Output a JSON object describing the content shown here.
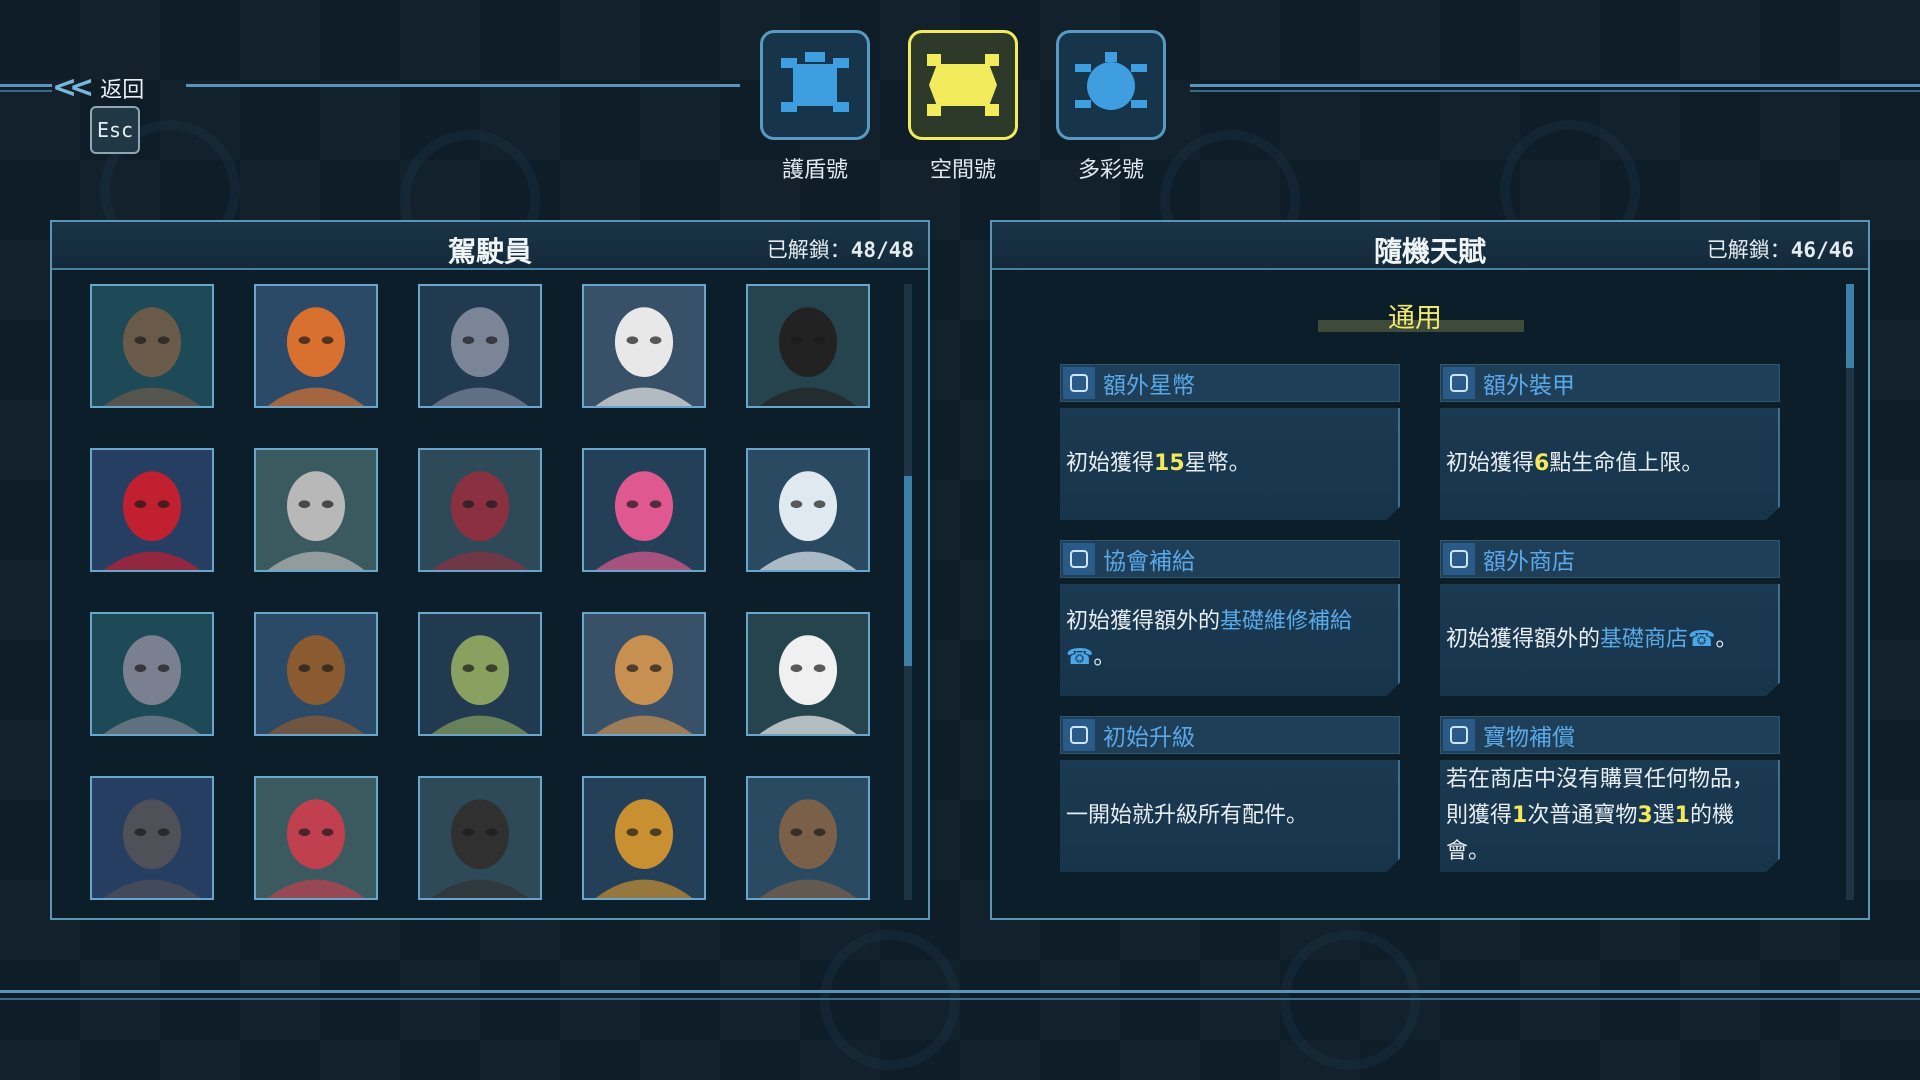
{
  "header": {
    "back_label": "返回",
    "esc_key": "Esc",
    "ships": [
      {
        "name": "護盾號",
        "icon": "shield-ship-icon",
        "active": false
      },
      {
        "name": "空間號",
        "icon": "space-ship-icon",
        "active": true
      },
      {
        "name": "多彩號",
        "icon": "colorful-ship-icon",
        "active": false
      }
    ]
  },
  "pilots_panel": {
    "title": "駕駛員",
    "unlocked_label": "已解鎖：",
    "unlocked_value": "48/48",
    "pilots": [
      "bearded-man-glasses",
      "orange-robot",
      "grey-robot",
      "hooded-figure",
      "black-dog",
      "red-mech",
      "husky-goggles",
      "girl-headphones",
      "pink-hair-girl",
      "white-hood-girl",
      "cyborg-scarf",
      "cowboy-robot",
      "green-hair-elf",
      "cat-scarf",
      "white-cat",
      "raccoon",
      "box-robot-hoodie",
      "man-headphones",
      "masked-blonde",
      "tree-ent"
    ],
    "scroll_fraction": 0.45
  },
  "talents_panel": {
    "title": "隨機天賦",
    "unlocked_label": "已解鎖：",
    "unlocked_value": "46/46",
    "section": "通用",
    "talents": [
      {
        "name": "額外星幣",
        "icon": "star-coin-icon",
        "parts": [
          [
            "初始獲得",
            ""
          ],
          [
            "15",
            "y"
          ],
          [
            "星幣。",
            ""
          ]
        ]
      },
      {
        "name": "額外裝甲",
        "icon": "armor-icon",
        "parts": [
          [
            "初始獲得",
            ""
          ],
          [
            "6",
            "y"
          ],
          [
            "點生命值上限。",
            ""
          ]
        ]
      },
      {
        "name": "協會補給",
        "icon": "guild-supply-icon",
        "parts": [
          [
            "初始獲得額外的",
            ""
          ],
          [
            "基礎維修補給",
            "b"
          ],
          [
            "☎",
            "p"
          ],
          [
            "。",
            ""
          ]
        ]
      },
      {
        "name": "額外商店",
        "icon": "shop-icon",
        "parts": [
          [
            "初始獲得額外的",
            ""
          ],
          [
            "基礎商店",
            "b"
          ],
          [
            "☎",
            "p"
          ],
          [
            "。",
            ""
          ]
        ]
      },
      {
        "name": "初始升級",
        "icon": "upgrade-icon",
        "parts": [
          [
            "一開始就升級所有配件。",
            ""
          ]
        ]
      },
      {
        "name": "寶物補償",
        "icon": "treasure-icon",
        "parts": [
          [
            "若在商店中沒有購買任何物品，則獲得",
            ""
          ],
          [
            "1",
            "y"
          ],
          [
            "次普通寶物",
            ""
          ],
          [
            "3",
            "y"
          ],
          [
            "選",
            ""
          ],
          [
            "1",
            "y"
          ],
          [
            "的機會。",
            ""
          ]
        ]
      }
    ],
    "scroll_fraction": 0.0
  },
  "colors": {
    "accent": "#5a95b8",
    "active_ship": "#f2ec5c",
    "highlight_yellow": "#f2e85a",
    "highlight_blue": "#5aaae8"
  }
}
